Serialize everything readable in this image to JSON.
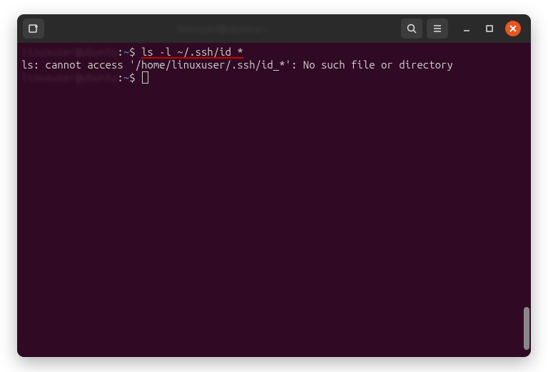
{
  "titlebar": {
    "title": "linuxuser@ubuntu:~"
  },
  "terminal": {
    "lines": [
      {
        "host": "linuxuser@ubuntu",
        "path": "~",
        "dollar": "$",
        "command": "ls -l ~/.ssh/id_*"
      }
    ],
    "output": "ls: cannot access '/home/linuxuser/.ssh/id_*': No such file or directory",
    "prompt2": {
      "host": "linuxuser@ubuntu",
      "path": "~",
      "dollar": "$"
    }
  }
}
